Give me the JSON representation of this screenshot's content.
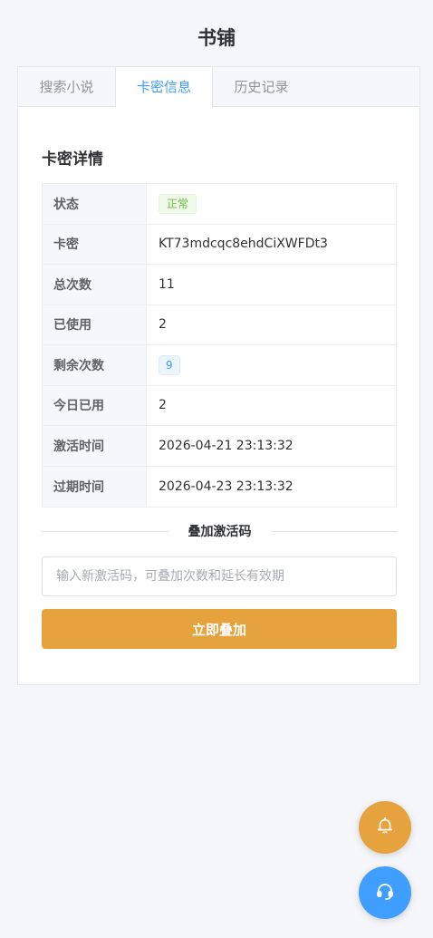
{
  "header": {
    "title": "书铺"
  },
  "tabs": [
    {
      "label": "搜索小说"
    },
    {
      "label": "卡密信息"
    },
    {
      "label": "历史记录"
    }
  ],
  "details": {
    "title": "卡密详情",
    "rows": [
      {
        "label": "状态",
        "value": "正常"
      },
      {
        "label": "卡密",
        "value": "KT73mdcqc8ehdCiXWFDt3"
      },
      {
        "label": "总次数",
        "value": "11"
      },
      {
        "label": "已使用",
        "value": "2"
      },
      {
        "label": "剩余次数",
        "value": "9"
      },
      {
        "label": "今日已用",
        "value": "2"
      },
      {
        "label": "激活时间",
        "value": "2026-04-21 23:13:32"
      },
      {
        "label": "过期时间",
        "value": "2026-04-23 23:13:32"
      }
    ]
  },
  "stack": {
    "divider_label": "叠加激活码",
    "input_value": "",
    "input_placeholder": "输入新激活码，可叠加次数和延长有效期",
    "button_label": "立即叠加"
  },
  "fabs": {
    "notification_icon": "bell-icon",
    "support_icon": "headset-icon"
  },
  "colors": {
    "accent": "#409eff",
    "warning": "#e6a23c",
    "success": "#67c23a"
  }
}
